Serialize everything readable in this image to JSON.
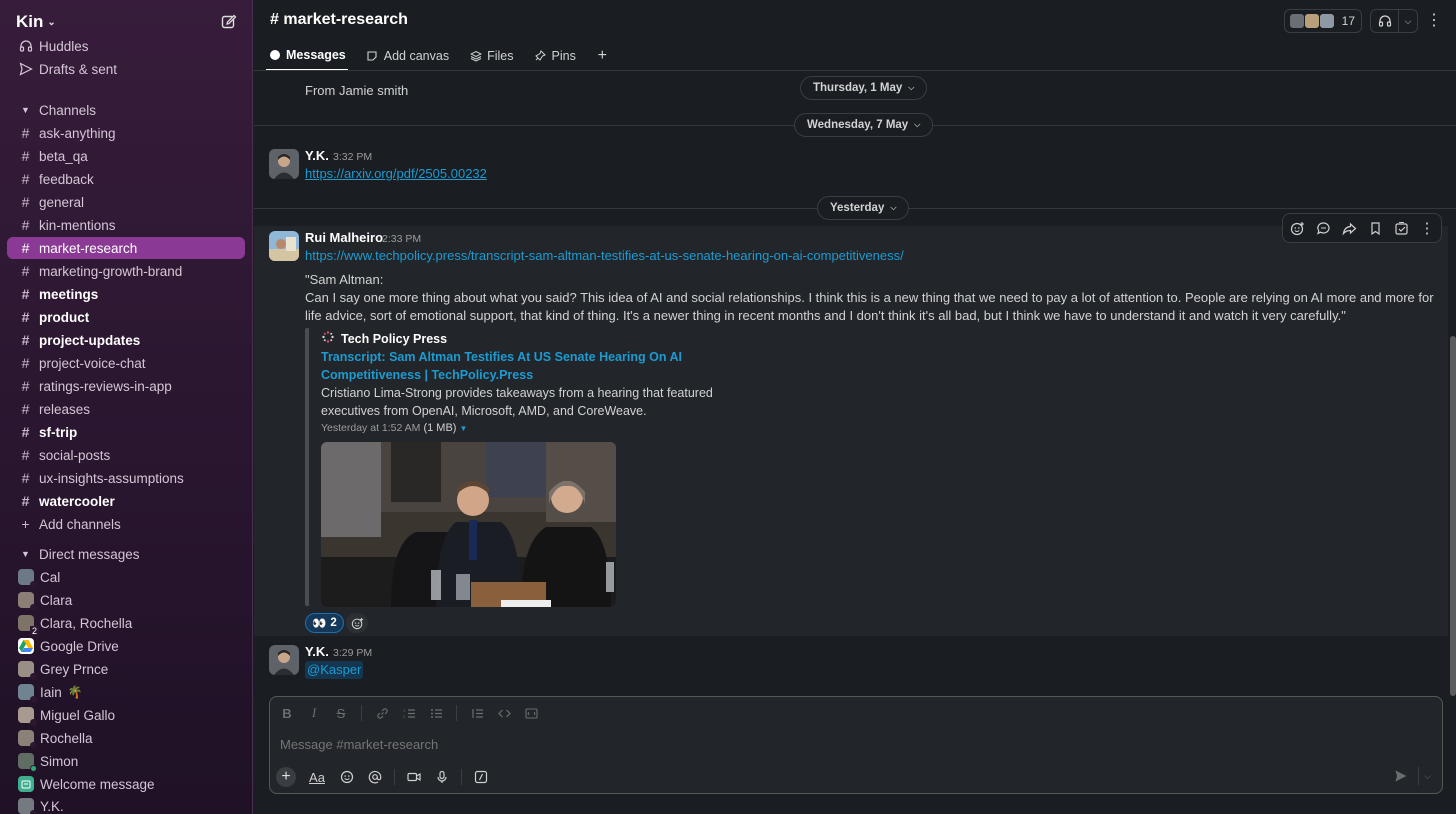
{
  "workspace": {
    "name": "Kin"
  },
  "sidebar": {
    "top": [
      {
        "label": "Huddles",
        "icon": "headphones-icon"
      },
      {
        "label": "Drafts & sent",
        "icon": "send-icon"
      }
    ],
    "channels_header": "Channels",
    "channels": [
      {
        "label": "ask-anything",
        "bold": false
      },
      {
        "label": "beta_qa",
        "bold": false
      },
      {
        "label": "feedback",
        "bold": false
      },
      {
        "label": "general",
        "bold": false
      },
      {
        "label": "kin-mentions",
        "bold": false
      },
      {
        "label": "market-research",
        "bold": false,
        "active": true
      },
      {
        "label": "marketing-growth-brand",
        "bold": false
      },
      {
        "label": "meetings",
        "bold": true
      },
      {
        "label": "product",
        "bold": true
      },
      {
        "label": "project-updates",
        "bold": true
      },
      {
        "label": "project-voice-chat",
        "bold": false
      },
      {
        "label": "ratings-reviews-in-app",
        "bold": false
      },
      {
        "label": "releases",
        "bold": false
      },
      {
        "label": "sf-trip",
        "bold": true
      },
      {
        "label": "social-posts",
        "bold": false
      },
      {
        "label": "ux-insights-assumptions",
        "bold": false
      },
      {
        "label": "watercooler",
        "bold": true
      }
    ],
    "add_channels": "Add channels",
    "dm_header": "Direct messages",
    "dms": [
      {
        "label": "Cal",
        "color": "#6b7a86",
        "online": false
      },
      {
        "label": "Clara",
        "color": "#8a7f76",
        "online": false
      },
      {
        "label": "Clara, Rochella",
        "color": "#7d7366",
        "count": "2"
      },
      {
        "label": "Google Drive",
        "color": "#ffffff",
        "app": true
      },
      {
        "label": "Grey Prnce",
        "color": "#9a8f85",
        "online": false
      },
      {
        "label": "Iain",
        "color": "#6f8490",
        "online": false,
        "emoji": "🌴"
      },
      {
        "label": "Miguel Gallo",
        "color": "#a89a8e",
        "online": false
      },
      {
        "label": "Rochella",
        "color": "#8c8177",
        "online": false
      },
      {
        "label": "Simon",
        "color": "#5f6d62",
        "online": true
      },
      {
        "label": "Welcome message",
        "color": "#3fae8f",
        "app": true
      },
      {
        "label": "Y.K.",
        "color": "#757a80",
        "online": false
      }
    ]
  },
  "header": {
    "channel": "# market-research",
    "member_count": "17",
    "tabs": [
      {
        "label": "Messages",
        "icon": "message-bubble-icon",
        "active": true
      },
      {
        "label": "Add canvas",
        "icon": "canvas-icon"
      },
      {
        "label": "Files",
        "icon": "files-stack-icon"
      },
      {
        "label": "Pins",
        "icon": "pin-icon"
      }
    ]
  },
  "messages": {
    "prev_tail": "From Jamie smith",
    "day1": "Thursday, 1 May",
    "day2": "Wednesday, 7 May",
    "m1": {
      "author": "Y.K.",
      "time": "3:32 PM",
      "link": "https://arxiv.org/pdf/2505.00232"
    },
    "day3": "Yesterday",
    "m2": {
      "author": "Rui Malheiro",
      "time": "2:33 PM",
      "link": "https://www.techpolicy.press/transcript-sam-altman-testifies-at-us-senate-hearing-on-ai-competitiveness/",
      "quote_title": "\"Sam Altman:",
      "quote_body": "Can I say one more thing about what you said? This idea of AI and social relationships. I think this is a new thing that we need to pay a lot of attention to. People are relying on AI more and more for life advice, sort of emotional support, that kind of thing. It's a newer thing in recent months and I don't think it's all bad, but I think we have to understand it and watch it very carefully.\"",
      "unfurl": {
        "site": "Tech Policy Press",
        "title": "Transcript: Sam Altman Testifies At US Senate Hearing On AI Competitiveness | TechPolicy.Press",
        "description": "Cristiano Lima-Strong provides takeaways from a hearing that featured executives from OpenAI, Microsoft, AMD, and CoreWeave.",
        "meta": "Yesterday at 1:52 AM",
        "size": "(1 MB)"
      },
      "reaction": {
        "emoji": "👀",
        "count": "2"
      }
    },
    "m3": {
      "author": "Y.K.",
      "time": "3:29 PM",
      "mention": "@Kasper"
    }
  },
  "composer": {
    "placeholder": "Message #market-research",
    "format_label": "Aa"
  }
}
